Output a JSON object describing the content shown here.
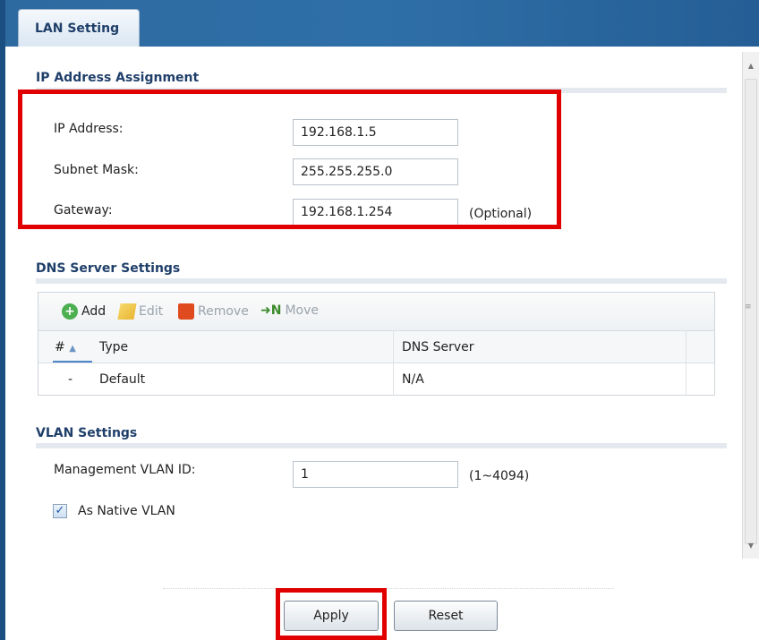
{
  "tab": {
    "label": "LAN Setting"
  },
  "ip_section": {
    "title": "IP Address Assignment",
    "fields": [
      {
        "label": "IP Address:",
        "value": "192.168.1.5"
      },
      {
        "label": "Subnet Mask:",
        "value": "255.255.255.0"
      },
      {
        "label": "Gateway:",
        "value": "192.168.1.254",
        "note": "(Optional)"
      }
    ]
  },
  "dns_section": {
    "title": "DNS Server Settings",
    "toolbar": {
      "add": "Add",
      "edit": "Edit",
      "remove": "Remove",
      "move": "Move"
    },
    "columns": {
      "num": "#",
      "type": "Type",
      "server": "DNS Server"
    },
    "rows": [
      {
        "num": "-",
        "type": "Default",
        "server": "N/A"
      }
    ]
  },
  "vlan_section": {
    "title": "VLAN Settings",
    "mgmt_label": "Management VLAN ID:",
    "mgmt_value": "1",
    "range_note": "(1~4094)",
    "native_label": "As Native VLAN",
    "native_checked": true
  },
  "buttons": {
    "apply": "Apply",
    "reset": "Reset"
  },
  "colors": {
    "highlight": "#e00000",
    "section_title": "#1f3f6a",
    "header_blue": "#2d6aa0"
  }
}
